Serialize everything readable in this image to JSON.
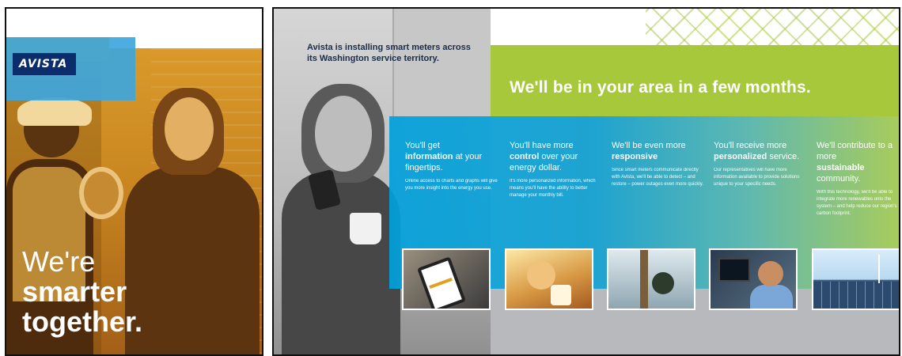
{
  "cover": {
    "logo_text": "AVISTA",
    "headline_line1": "We're",
    "headline_line2": "smarter",
    "headline_line3": "together."
  },
  "spread": {
    "intro_text": "Avista is installing smart meters across its Washington service territory.",
    "headline": "We'll be in your area in a few months.",
    "columns": [
      {
        "heading_pre": "You'll get",
        "heading_bold": "information",
        "heading_post": "at your fingertips.",
        "body": "Online access to charts and graphs will give you more insight into the energy you use."
      },
      {
        "heading_pre": "You'll have more",
        "heading_bold": "control",
        "heading_post": "over your energy dollar.",
        "body": "It's more personalized information, which means you'll have the ability to better manage your monthly bill."
      },
      {
        "heading_pre": "We'll be even more",
        "heading_bold": "responsive",
        "heading_post": "",
        "body": "Since smart meters communicate directly with Avista, we'll be able to detect – and restore – power outages even more quickly."
      },
      {
        "heading_pre": "You'll receive more",
        "heading_bold": "personalized",
        "heading_post": "service.",
        "body": "Our representatives will have more information available to provide solutions unique to your specific needs."
      },
      {
        "heading_pre": "We'll contribute to a more",
        "heading_bold": "sustainable",
        "heading_post": "community.",
        "body": "With this technology, we'll be able to integrate more renewables onto the system – and help reduce our region's carbon footprint."
      }
    ]
  },
  "colors": {
    "cover_orange": "#d99a2a",
    "avista_navy": "#0c2d6b",
    "brand_blue": "#3ea6dc",
    "spread_green": "#a7c83a",
    "spread_gray": "#b7b9bc"
  }
}
